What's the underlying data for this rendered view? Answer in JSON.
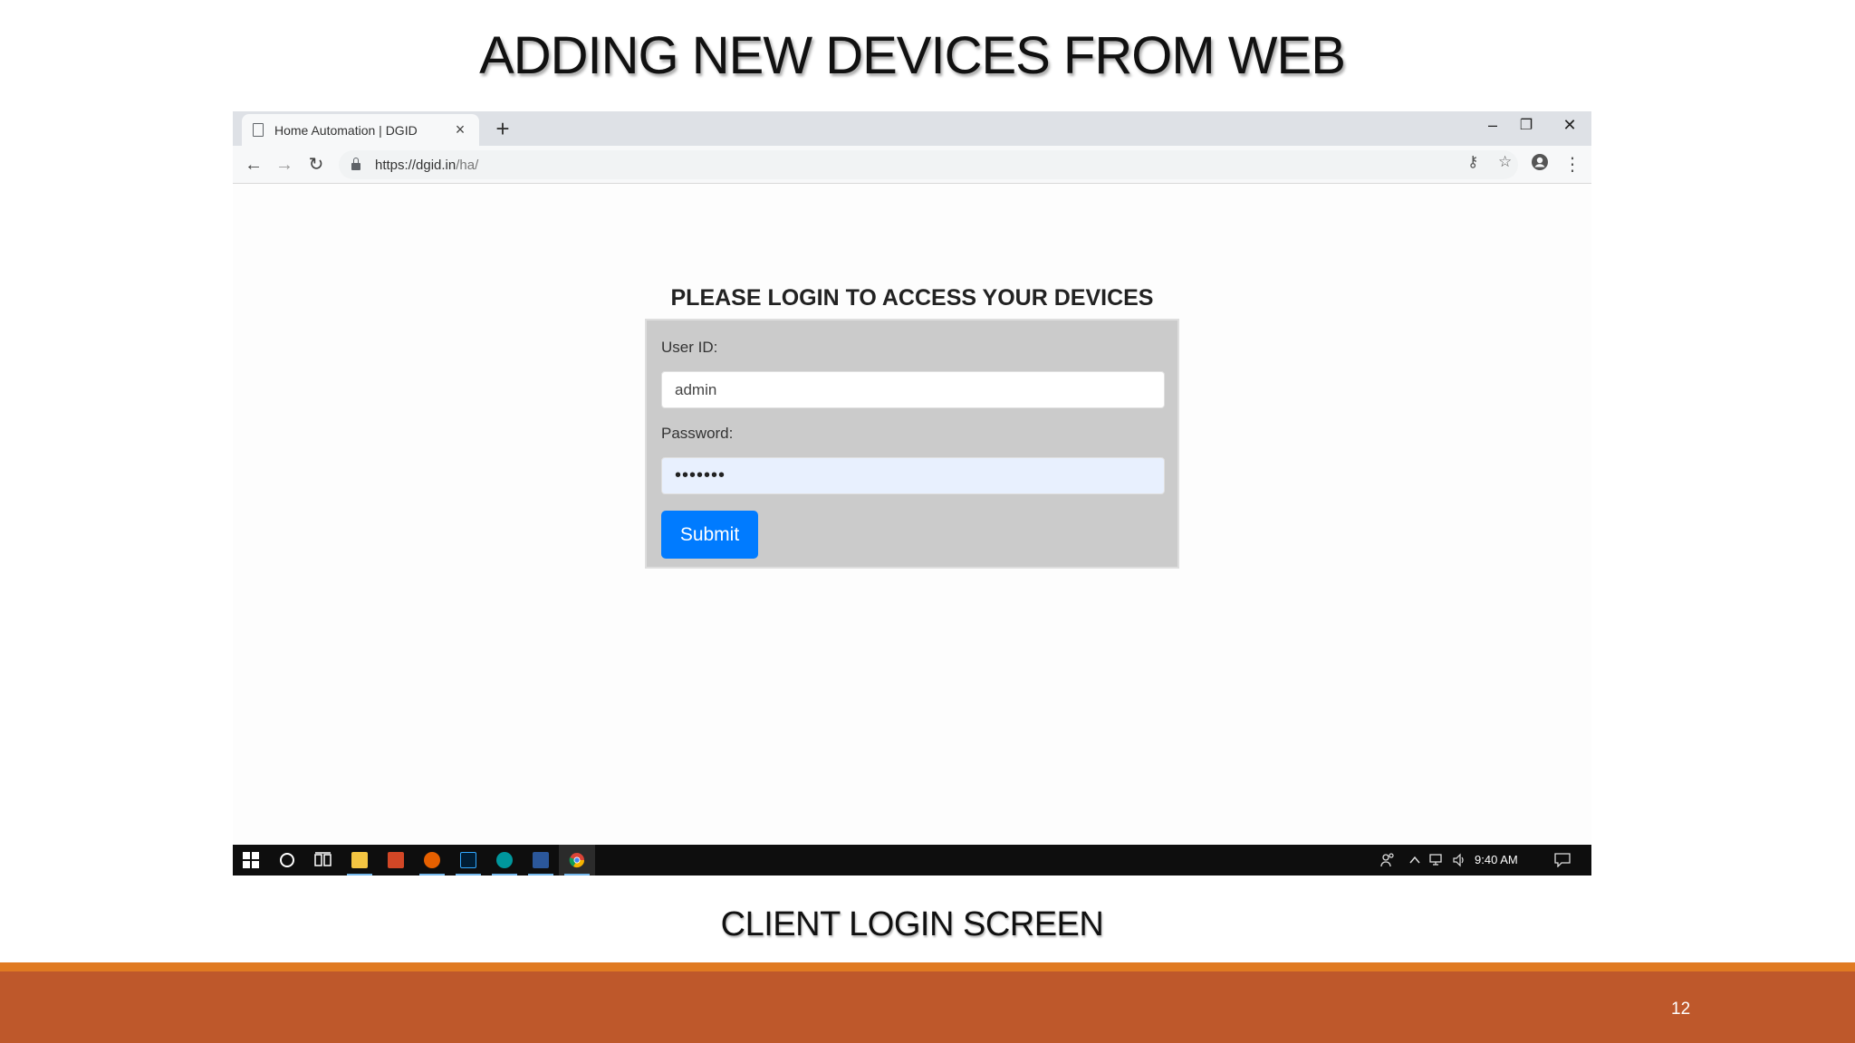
{
  "slide": {
    "title": "ADDING NEW DEVICES FROM WEB",
    "caption": "CLIENT LOGIN SCREEN",
    "page_number": "12"
  },
  "browser": {
    "tab_title": "Home Automation | DGID",
    "tab_close": "×",
    "new_tab": "+",
    "url_host": "https://dgid.in",
    "url_path": "/ha/",
    "minimize": "–",
    "restore": "❐",
    "close": "✕",
    "back": "←",
    "forward": "→",
    "reload": "↻",
    "key_icon": "⚷",
    "star_icon": "☆",
    "menu_icon": "⋮"
  },
  "login": {
    "heading": "PLEASE LOGIN TO ACCESS YOUR DEVICES",
    "user_label": "User ID:",
    "user_value": "admin",
    "password_label": "Password:",
    "password_value": "•••••••",
    "submit_label": "Submit"
  },
  "taskbar": {
    "clock": "9:40 AM",
    "apps": [
      "start-icon",
      "search-icon",
      "task-view-icon",
      "file-explorer-icon",
      "powerpoint-icon",
      "firefox-icon",
      "photoshop-icon",
      "arduino-icon",
      "word-icon",
      "chrome-icon"
    ]
  },
  "colors": {
    "accent_submit": "#007bff",
    "footer": "#be582b",
    "footer_line": "#e07a22"
  }
}
